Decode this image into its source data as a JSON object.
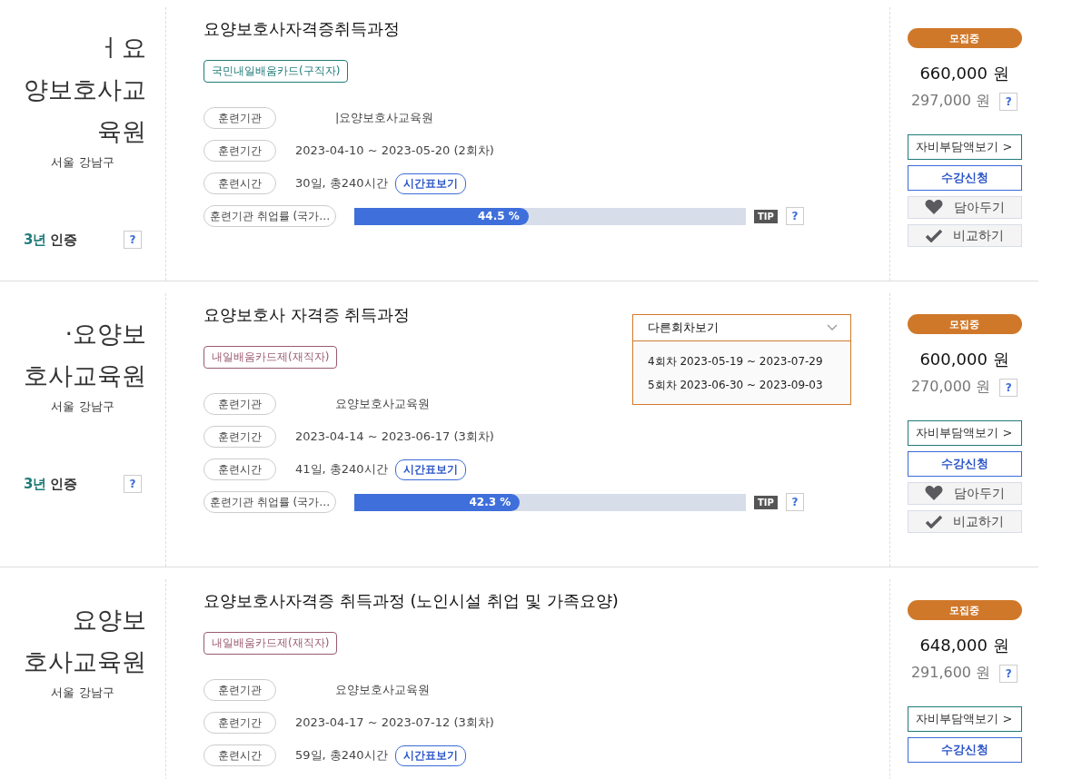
{
  "courses": [
    {
      "logo_lines": [
        "ㅓ요",
        "양보호사교",
        "육원"
      ],
      "region": "서울 강남구",
      "certification": {
        "years": "3년",
        "label": "인증",
        "help": "?"
      },
      "title": "요양보호사자격증취득과정",
      "tag": {
        "label": "국민내일배움카드(구직자)",
        "color": "#1e7b78"
      },
      "rows": [
        {
          "label": "훈련기관",
          "value": "|요양보호사교육원",
          "kind": "institution"
        },
        {
          "label": "훈련기간",
          "value": "2023-04-10 ~ 2023-05-20 (2회차)",
          "kind": "text"
        },
        {
          "label": "훈련시간",
          "value": "30일, 총240시간",
          "kind": "schedule",
          "button": "시간표보기"
        },
        {
          "label": "훈련기관 취업률 (국가…",
          "kind": "rate",
          "level": 0.445,
          "reading": "44.5 %",
          "tip": "TIP",
          "help": "?"
        }
      ],
      "status": "모집중",
      "price": "660,000 원",
      "self_pay": "297,000 원",
      "self_pay_help": "?",
      "buttons": [
        {
          "label": "자비부담액보기 >",
          "kind": "outline"
        },
        {
          "label": "수강신청",
          "kind": "apply"
        },
        {
          "label": "담아두기",
          "kind": "save"
        },
        {
          "label": "비교하기",
          "kind": "compare"
        }
      ]
    },
    {
      "logo_lines": [
        "·요양보",
        "호사교육원"
      ],
      "region": "서울 강남구",
      "certification": {
        "years": "3년",
        "label": "인증",
        "help": "?"
      },
      "title": "요양보호사 자격증 취득과정",
      "tag": {
        "label": "내일배움카드제(재직자)",
        "color": "#9a5a70"
      },
      "dropdown": {
        "label": "다른회차보기",
        "expanded": true,
        "options": [
          "4회차 2023-05-19 ~ 2023-07-29",
          "5회차 2023-06-30 ~ 2023-09-03"
        ]
      },
      "rows": [
        {
          "label": "훈련기관",
          "value": "요양보호사교육원",
          "kind": "institution"
        },
        {
          "label": "훈련기간",
          "value": "2023-04-14 ~ 2023-06-17 (3회차)",
          "kind": "text"
        },
        {
          "label": "훈련시간",
          "value": "41일, 총240시간",
          "kind": "schedule",
          "button": "시간표보기"
        },
        {
          "label": "훈련기관 취업률 (국가…",
          "kind": "rate",
          "level": 0.423,
          "reading": "42.3 %",
          "tip": "TIP",
          "help": "?"
        }
      ],
      "status": "모집중",
      "price": "600,000 원",
      "self_pay": "270,000 원",
      "self_pay_help": "?",
      "buttons": [
        {
          "label": "자비부담액보기 >",
          "kind": "outline"
        },
        {
          "label": "수강신청",
          "kind": "apply"
        },
        {
          "label": "담아두기",
          "kind": "save"
        },
        {
          "label": "비교하기",
          "kind": "compare"
        }
      ]
    },
    {
      "logo_lines": [
        "요양보",
        "호사교육원"
      ],
      "region": "서울 강남구",
      "title": "요양보호사자격증 취득과정 (노인시설 취업 및 가족요양)",
      "tag": {
        "label": "내일배움카드제(재직자)",
        "color": "#9a5a70"
      },
      "rows": [
        {
          "label": "훈련기관",
          "value": "요양보호사교육원",
          "kind": "institution"
        },
        {
          "label": "훈련기간",
          "value": "2023-04-17 ~ 2023-07-12 (3회차)",
          "kind": "text"
        },
        {
          "label": "훈련시간",
          "value": "59일, 총240시간",
          "kind": "schedule",
          "button": "시간표보기"
        }
      ],
      "status": "모집중",
      "price": "648,000 원",
      "self_pay": "291,600 원",
      "self_pay_help": "?",
      "buttons": [
        {
          "label": "자비부담액보기 >",
          "kind": "outline"
        },
        {
          "label": "수강신청",
          "kind": "apply"
        }
      ]
    }
  ]
}
